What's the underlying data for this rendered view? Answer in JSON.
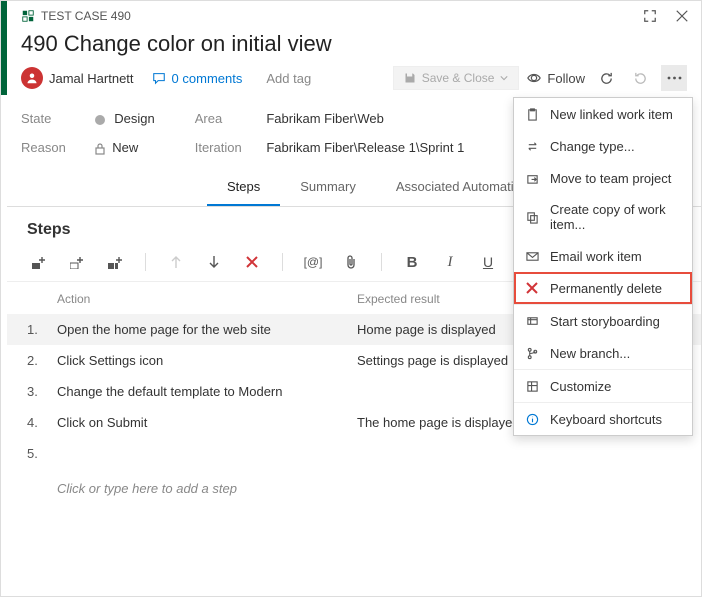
{
  "titlebar": {
    "type_label": "TEST CASE 490"
  },
  "header": {
    "title": "490  Change color on initial view",
    "assignee": "Jamal Hartnett",
    "comments": "0 comments",
    "add_tag": "Add tag",
    "save_close": "Save & Close",
    "follow": "Follow"
  },
  "fields": {
    "state_label": "State",
    "state_value": "Design",
    "reason_label": "Reason",
    "reason_value": "New",
    "area_label": "Area",
    "area_value": "Fabrikam Fiber\\Web",
    "iteration_label": "Iteration",
    "iteration_value": "Fabrikam Fiber\\Release 1\\Sprint 1"
  },
  "tabs": {
    "steps": "Steps",
    "summary": "Summary",
    "assoc": "Associated Automation"
  },
  "steps": {
    "heading": "Steps",
    "col_action": "Action",
    "col_expected": "Expected result",
    "rows": [
      {
        "n": "1.",
        "action": "Open the home page for the web site",
        "expected": "Home page is displayed"
      },
      {
        "n": "2.",
        "action": "Click Settings icon",
        "expected": "Settings page is displayed"
      },
      {
        "n": "3.",
        "action": "Change the default template to Modern",
        "expected": ""
      },
      {
        "n": "4.",
        "action": "Click on Submit",
        "expected": "The home page is displayed with the Modern look"
      },
      {
        "n": "5.",
        "action": "",
        "expected": ""
      }
    ],
    "placeholder": "Click or type here to add a step"
  },
  "menu": {
    "new_linked": "New linked work item",
    "change_type": "Change type...",
    "move_team": "Move to team project",
    "create_copy": "Create copy of work item...",
    "email": "Email work item",
    "perm_delete": "Permanently delete",
    "storyboard": "Start storyboarding",
    "new_branch": "New branch...",
    "customize": "Customize",
    "shortcuts": "Keyboard shortcuts"
  }
}
